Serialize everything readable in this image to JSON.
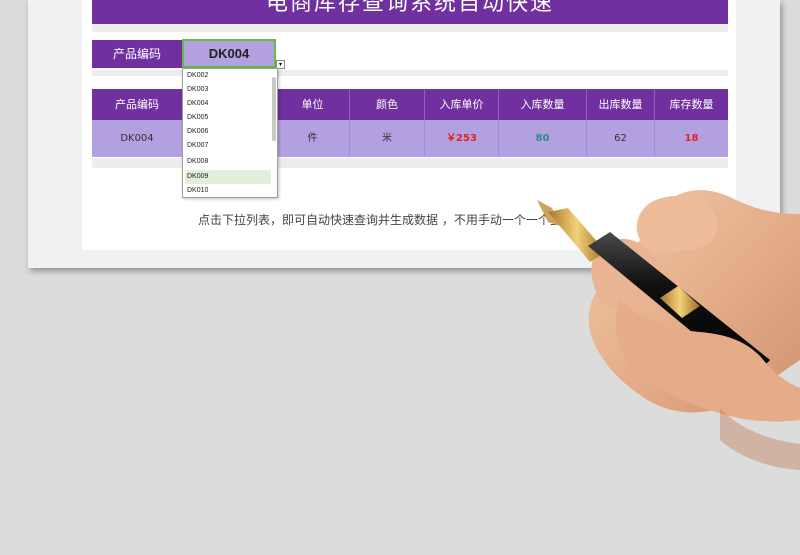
{
  "title": "电商库存查询系统自动快速",
  "query": {
    "label": "产品编码",
    "value": "DK004",
    "arrow": "▾"
  },
  "dropdown": {
    "options": [
      "DK002",
      "DK003",
      "DK004",
      "DK005",
      "DK006",
      "DK007",
      "DK008",
      "DK009",
      "DK010"
    ],
    "highlighted": "DK009"
  },
  "table": {
    "headers": [
      "产品编码",
      "单位",
      "颜色",
      "入库单价",
      "入库数量",
      "出库数量",
      "库存数量"
    ],
    "row": {
      "code": "DK004",
      "unit": "件",
      "color": "米",
      "in_price": "￥253",
      "in_qty": "80",
      "out_qty": "62",
      "stock_qty": "18"
    }
  },
  "note": "点击下拉列表，即可自动快速查询并生成数据 ，不用手动一个一个查询",
  "colors": {
    "header_purple": "#7030a0",
    "cell_lavender": "#b3a0e0",
    "price_red": "#e0242a",
    "in_qty_teal": "#2e8b87",
    "stock_red": "#e0242a",
    "selected_green": "#e2efda"
  }
}
